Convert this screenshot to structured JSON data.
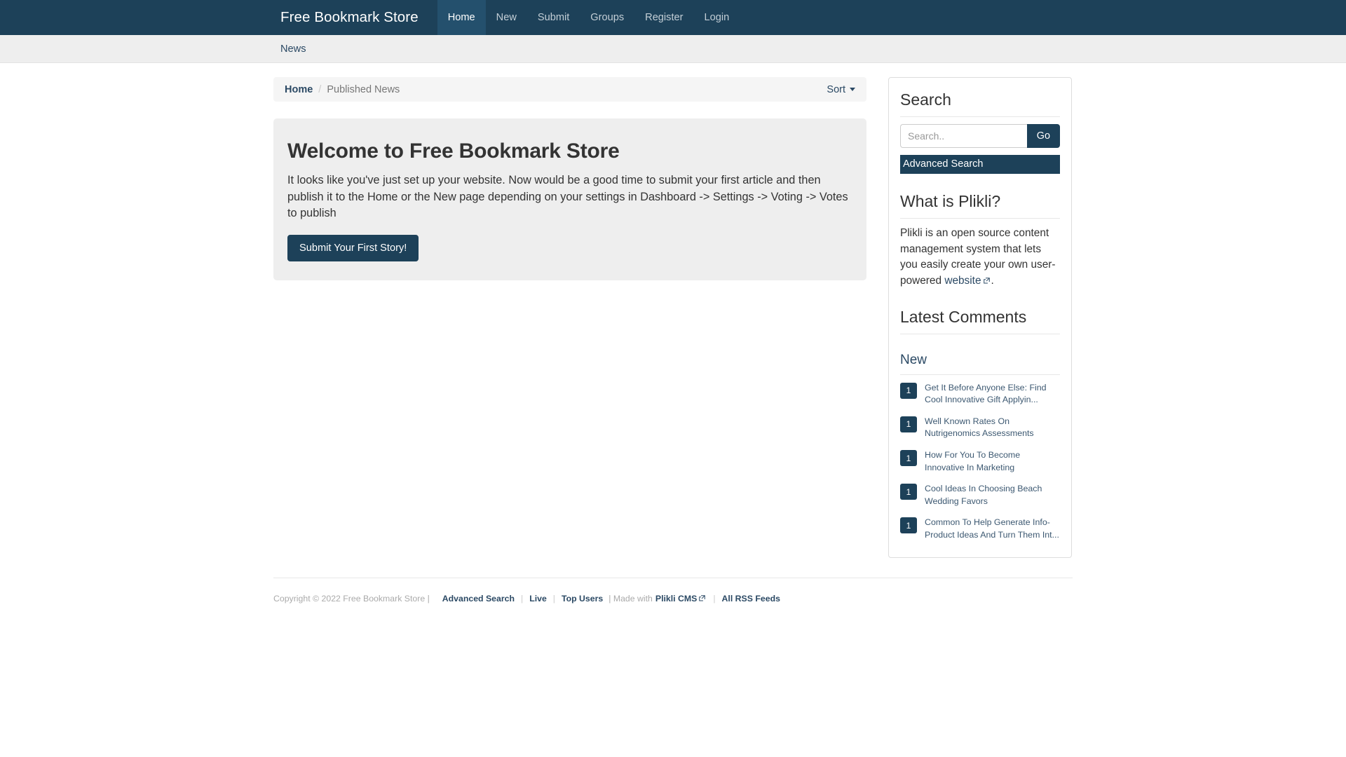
{
  "navbar": {
    "brand": "Free Bookmark Store",
    "items": [
      {
        "label": "Home",
        "active": true
      },
      {
        "label": "New",
        "active": false
      },
      {
        "label": "Submit",
        "active": false
      },
      {
        "label": "Groups",
        "active": false
      },
      {
        "label": "Register",
        "active": false
      },
      {
        "label": "Login",
        "active": false
      }
    ]
  },
  "subnav": {
    "items": [
      {
        "label": "News"
      }
    ]
  },
  "breadcrumb": {
    "home_label": "Home",
    "separator": "/",
    "current_label": "Published News",
    "sort_label": "Sort"
  },
  "jumbotron": {
    "heading": "Welcome to Free Bookmark Store",
    "body": "It looks like you've just set up your website. Now would be a good time to submit your first article and then publish it to the Home or the New page depending on your settings in Dashboard -> Settings -> Voting -> Votes to publish",
    "button_label": "Submit Your First Story!"
  },
  "sidebar": {
    "search": {
      "heading": "Search",
      "placeholder": "Search..",
      "value": "",
      "go_label": "Go",
      "advanced_label": "Advanced Search"
    },
    "about": {
      "heading": "What is Plikli?",
      "text_before": "Plikli is an open source content management system that lets you easily create your own user-powered ",
      "link_label": "website",
      "text_after": "."
    },
    "latest_comments": {
      "heading": "Latest Comments"
    },
    "new": {
      "heading": "New",
      "stories": [
        {
          "votes": "1",
          "title": "Get It Before Anyone Else: Find Cool Innovative Gift Applyin..."
        },
        {
          "votes": "1",
          "title": "Well Known Rates On Nutrigenomics Assessments"
        },
        {
          "votes": "1",
          "title": "How For You To Become Innovative In Marketing"
        },
        {
          "votes": "1",
          "title": "Cool Ideas In Choosing Beach Wedding Favors"
        },
        {
          "votes": "1",
          "title": "Common To Help Generate Info-Product Ideas And Turn Them Int..."
        }
      ]
    }
  },
  "footer": {
    "copyright": "Copyright © 2022 Free Bookmark Store |",
    "advanced_search": "Advanced Search",
    "live": "Live",
    "top_users": "Top Users",
    "made_with": "| Made with",
    "plikli_cms": "Plikli CMS",
    "all_rss": "All RSS Feeds",
    "sep": "|"
  },
  "colors": {
    "brand_dark": "#1d4159",
    "nav_active": "#24506d",
    "link": "#2b4964",
    "panel_bg": "#eeeeee"
  }
}
